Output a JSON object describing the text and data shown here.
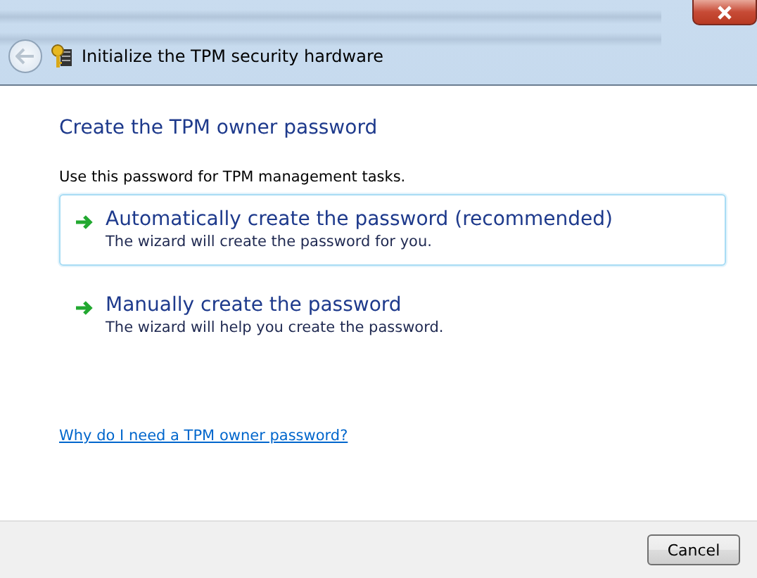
{
  "window": {
    "title": "Initialize the TPM security hardware"
  },
  "heading": "Create the TPM owner password",
  "description": "Use this password for TPM management tasks.",
  "options": [
    {
      "title": "Automatically create the password (recommended)",
      "subtitle": "The wizard will create the password for you.",
      "selected": true
    },
    {
      "title": "Manually create the password",
      "subtitle": "The wizard will help you create the password.",
      "selected": false
    }
  ],
  "help_link": "Why do I need a TPM owner password?",
  "buttons": [
    "Cancel"
  ]
}
